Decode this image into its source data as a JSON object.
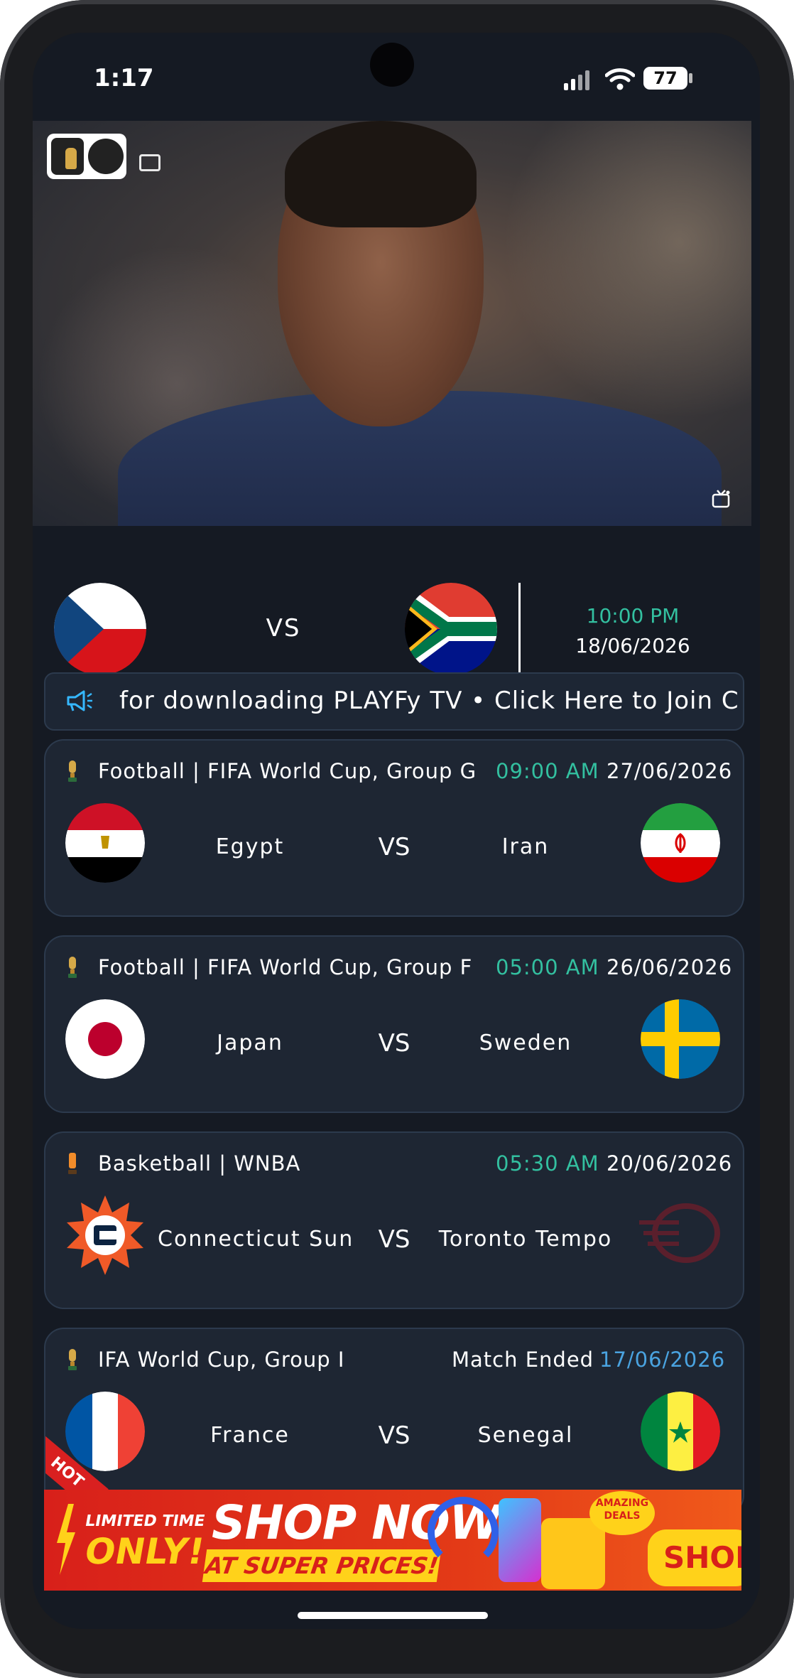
{
  "status_bar": {
    "time": "1:17",
    "battery": "77"
  },
  "featured_match": {
    "home_flag": "czech-republic",
    "away_flag": "south-africa",
    "vs": "VS",
    "time": "10:00 PM",
    "date": "18/06/2026"
  },
  "announcement": {
    "text": "for downloading PLAYFy TV • Click Here to Join C"
  },
  "matches": [
    {
      "league": "Football | FIFA World Cup, Group G",
      "time": "09:00 AM",
      "date": "27/06/2026",
      "home": "Egypt",
      "vs": "VS",
      "away": "Iran"
    },
    {
      "league": "Football | FIFA World Cup, Group F",
      "time": "05:00 AM",
      "date": "26/06/2026",
      "home": "Japan",
      "vs": "VS",
      "away": "Sweden"
    },
    {
      "league": "Basketball | WNBA",
      "time": "05:30 AM",
      "date": "20/06/2026",
      "home": "Connecticut Sun",
      "vs": "VS",
      "away": "Toronto Tempo"
    },
    {
      "league": "IFA World Cup, Group I",
      "status": "Match Ended",
      "date": "17/06/2026",
      "home": "France",
      "vs": "VS",
      "away": "Senegal",
      "badge": "HOT"
    }
  ],
  "ad": {
    "limited": "LIMITED TIME",
    "only": "ONLY!",
    "shop_now": "SHOP NOW",
    "super_prices": "AT SUPER PRICES!",
    "amazing": "AMAZING DEALS",
    "button": "SHOP"
  },
  "colors": {
    "accent_time": "#33c0a0",
    "ended_date": "#4aa3e0",
    "card_bg": "#1e2633",
    "screen_bg": "#151a23"
  }
}
